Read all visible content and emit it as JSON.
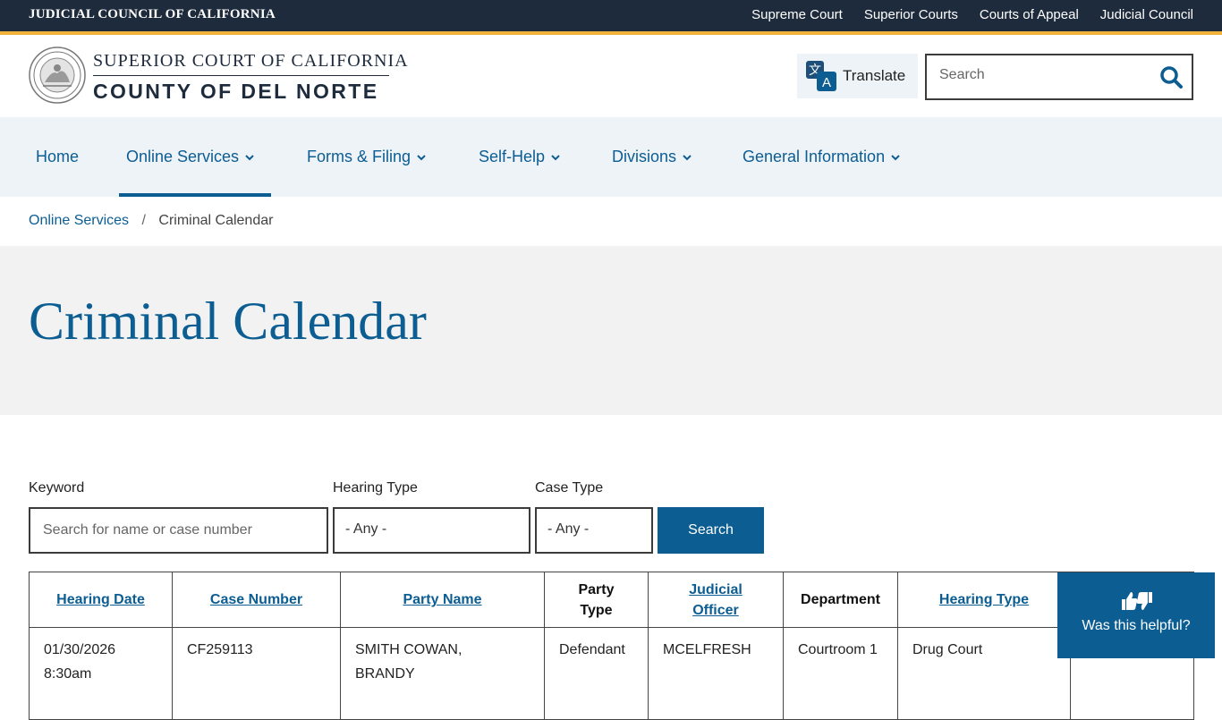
{
  "topbar": {
    "org": "JUDICIAL COUNCIL OF CALIFORNIA",
    "links": [
      "Supreme Court",
      "Superior Courts",
      "Courts of Appeal",
      "Judicial Council"
    ]
  },
  "header": {
    "brand_line1": "SUPERIOR COURT OF CALIFORNIA",
    "brand_line2": "COUNTY OF DEL NORTE",
    "translate_label": "Translate",
    "search_placeholder": "Search"
  },
  "nav": {
    "items": [
      {
        "label": "Home"
      },
      {
        "label": "Online Services"
      },
      {
        "label": "Forms & Filing"
      },
      {
        "label": "Self-Help"
      },
      {
        "label": "Divisions"
      },
      {
        "label": "General Information"
      }
    ]
  },
  "breadcrumb": {
    "parent": "Online Services",
    "current": "Criminal Calendar"
  },
  "page": {
    "title": "Criminal Calendar"
  },
  "filters": {
    "keyword_label": "Keyword",
    "keyword_placeholder": "Search for name or case number",
    "hearing_type_label": "Hearing Type",
    "hearing_type_value": "- Any -",
    "case_type_label": "Case Type",
    "case_type_value": "- Any -",
    "search_button": "Search"
  },
  "table": {
    "headers": {
      "hearing_date": "Hearing Date",
      "case_number": "Case Number",
      "party_name": "Party Name",
      "party_type_1": "Party",
      "party_type_2": "Type",
      "judicial_officer_1": "Judicial",
      "judicial_officer_2": "Officer",
      "department": "Department",
      "hearing_type": "Hearing Type"
    },
    "rows": [
      {
        "date_1": "01/30/2026",
        "date_2": "8:30am",
        "case_number": "CF259113",
        "party_name_1": "SMITH COWAN,",
        "party_name_2": "BRANDY",
        "party_type": "Defendant",
        "judicial_officer": "MCELFRESH",
        "department": "Courtroom 1",
        "hearing_type": "Drug Court"
      }
    ]
  },
  "helpful": {
    "label": "Was this helpful?"
  },
  "colors": {
    "primary": "#0c5d92",
    "topbar": "#1e2b3c",
    "accent": "#f2b33d",
    "nav_bg": "#eef3f8",
    "hero_bg": "#f2f2f2"
  }
}
